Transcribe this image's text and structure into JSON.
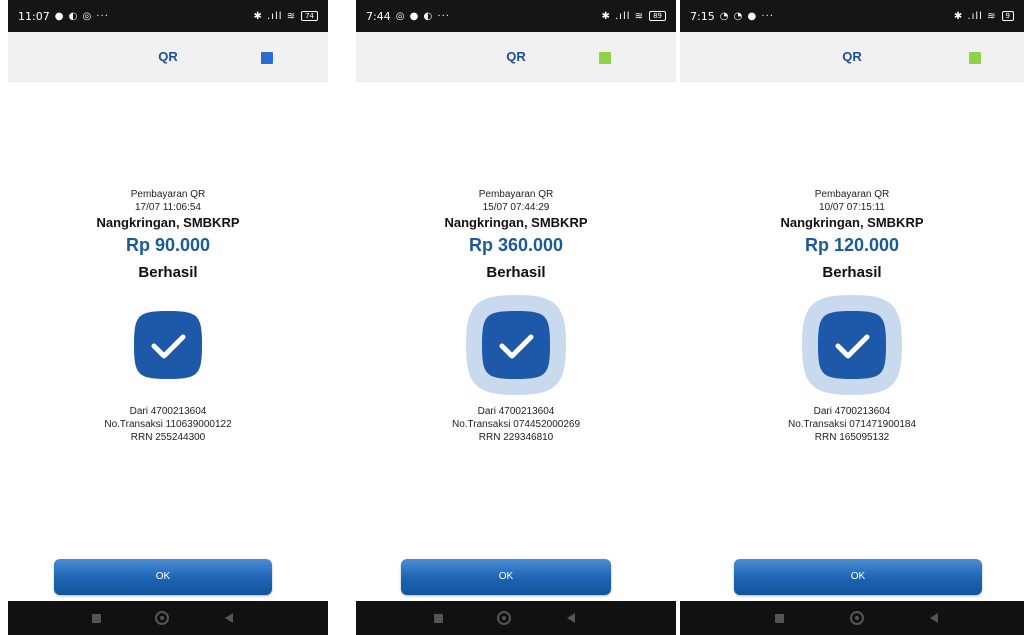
{
  "screens": [
    {
      "status_time": "11:07",
      "status_icons": "● ◐ ◎ ···",
      "signal_icons": "✱ .ıll ≋",
      "battery": "74",
      "title": "QR",
      "indicator_color": "#2a6bd4",
      "label": "Pembayaran QR",
      "datetime": "17/07 11:06:54",
      "merchant": "Nangkringan, SMBKRP",
      "amount": "Rp 90.000",
      "status": "Berhasil",
      "from": "Dari 4700213604",
      "transaction": "No.Transaksi 110639000122",
      "rrn": "RRN 255244300",
      "ok_label": "OK",
      "halo_level": 0
    },
    {
      "status_time": "7:44",
      "status_icons": "◎ ● ◐ ···",
      "signal_icons": "✱ .ıll ≋",
      "battery": "89",
      "title": "QR",
      "indicator_color": "#8fd24a",
      "label": "Pembayaran QR",
      "datetime": "15/07 07:44:29",
      "merchant": "Nangkringan, SMBKRP",
      "amount": "Rp 360.000",
      "status": "Berhasil",
      "from": "Dari 4700213604",
      "transaction": "No.Transaksi 074452000269",
      "rrn": "RRN 229346810",
      "ok_label": "OK",
      "halo_level": 1
    },
    {
      "status_time": "7:15",
      "status_icons": "◔ ◔ ●  ···",
      "signal_icons": "✱ .ıll ≋",
      "battery": "9",
      "title": "QR",
      "indicator_color": "#8fd24a",
      "label": "Pembayaran QR",
      "datetime": "10/07 07:15:11",
      "merchant": "Nangkringan, SMBKRP",
      "amount": "Rp 120.000",
      "status": "Berhasil",
      "from": "Dari 4700213604",
      "transaction": "No.Transaksi 071471900184",
      "rrn": "RRN 165095132",
      "ok_label": "OK",
      "halo_level": 1
    }
  ],
  "colors": {
    "primary": "#1c4f96",
    "amount": "#1b5a9a",
    "check_fill": "#1e58a8",
    "halo": "#c9daee"
  }
}
